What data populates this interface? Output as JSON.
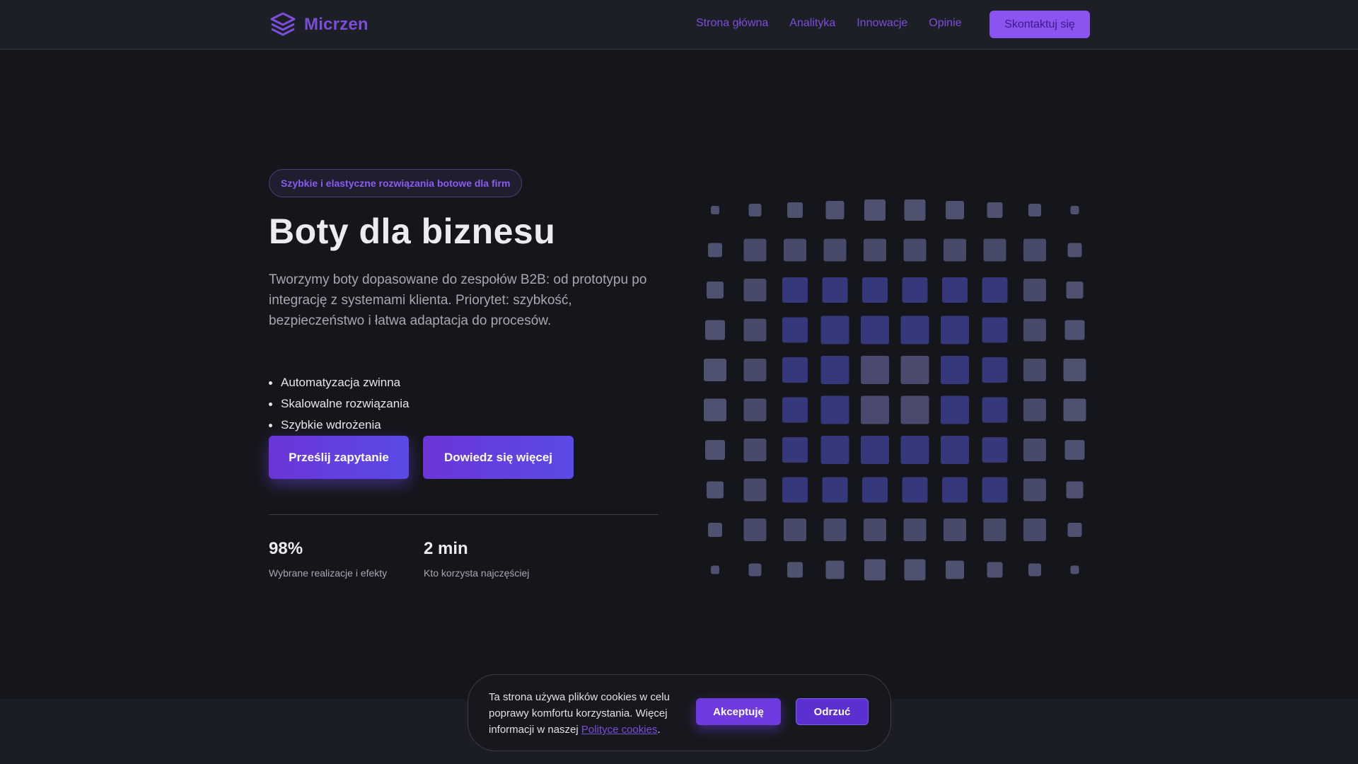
{
  "brand": {
    "name": "Micrzen",
    "color": "#7c4ddb"
  },
  "nav": {
    "links": [
      "Strona główna",
      "Analityka",
      "Innowacje",
      "Opinie"
    ],
    "cta": "Skontaktuj się"
  },
  "hero": {
    "badge": "Szybkie i elastyczne rozwiązania botowe dla firm",
    "title": "Boty dla biznesu",
    "description": "Tworzymy boty dopasowane do zespołów B2B: od prototypu po integrację z systemami klienta. Priorytet: szybkość, bezpieczeństwo i łatwa adaptacja do procesów.",
    "features": [
      "Automatyzacja zwinna",
      "Skalowalne rozwiązania",
      "Szybkie wdrożenia"
    ],
    "primary_button": "Prześlij zapytanie",
    "secondary_button": "Dowiedz się więcej",
    "stats": [
      {
        "value": "98%",
        "label": "Wybrane realizacje i efekty"
      },
      {
        "value": "2 min",
        "label": "Kto korzysta najczęściej"
      }
    ]
  },
  "cookie": {
    "text_before_link": "Ta strona używa plików cookies w celu poprawy komfortu korzystania. Więcej informacji w naszej ",
    "link_text": "Polityce cookies",
    "text_after_link": ".",
    "accept": "Akceptuję",
    "reject": "Odrzuć"
  },
  "icons": {
    "logo": "layers-stack-icon",
    "list_bullet": "bullet-dot-icon"
  },
  "colors": {
    "accent": "#8b54f0",
    "background": "#15161b",
    "tile_blue": "#35387a",
    "tile_gray": "#4a4d6a"
  }
}
